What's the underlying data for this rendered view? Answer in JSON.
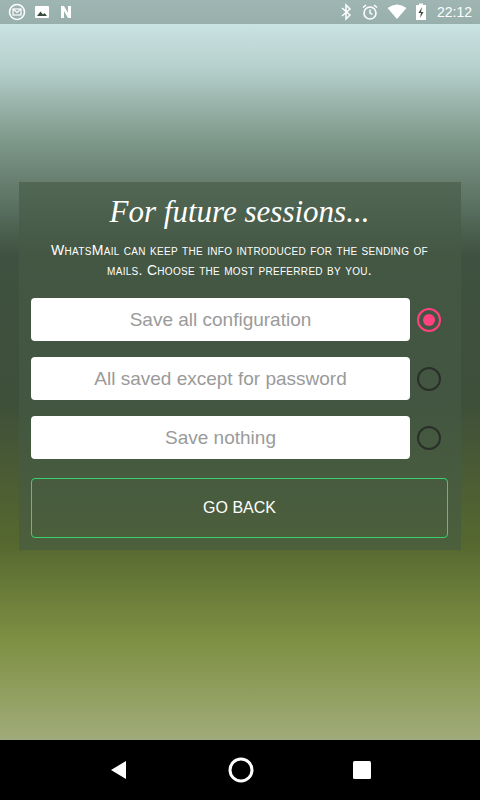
{
  "status_bar": {
    "time": "22:12"
  },
  "dialog": {
    "title": "For future sessions...",
    "description": "WhatsMail can keep the info introduced for the sending of mails. Choose the most preferred by you."
  },
  "options": [
    {
      "label": "Save all configuration",
      "selected": true
    },
    {
      "label": "All saved except for password",
      "selected": false
    },
    {
      "label": "Save nothing",
      "selected": false
    }
  ],
  "buttons": [
    "GO BACK"
  ]
}
